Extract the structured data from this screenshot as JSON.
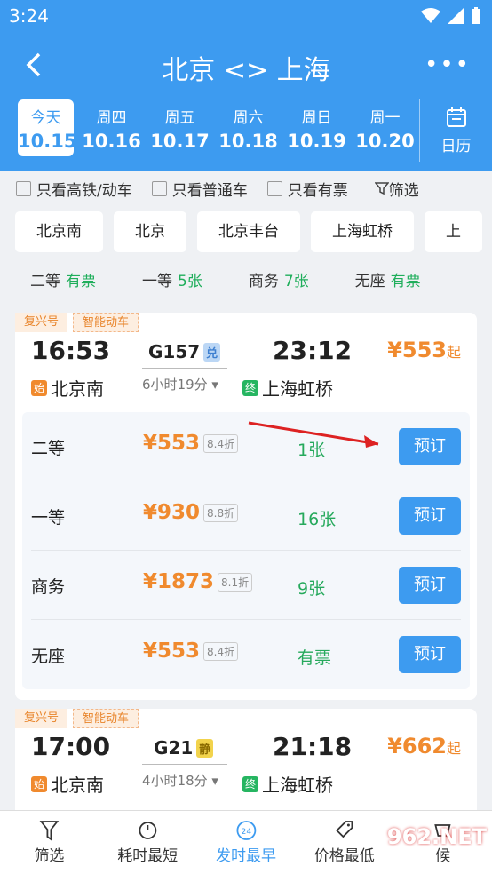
{
  "status_bar": {
    "time": "3:24"
  },
  "nav": {
    "title": "北京 <> 上海",
    "more": "•••"
  },
  "dates": [
    {
      "week": "今天",
      "date": "10.15",
      "active": true
    },
    {
      "week": "周四",
      "date": "10.16"
    },
    {
      "week": "周五",
      "date": "10.17"
    },
    {
      "week": "周六",
      "date": "10.18"
    },
    {
      "week": "周日",
      "date": "10.19"
    },
    {
      "week": "周一",
      "date": "10.20"
    }
  ],
  "calendar_label": "日历",
  "filters": {
    "high_speed": "只看高铁/动车",
    "normal": "只看普通车",
    "available": "只看有票",
    "screen": "筛选"
  },
  "stations": [
    "北京南",
    "北京",
    "北京丰台",
    "上海虹桥",
    "上"
  ],
  "seat_summary": [
    {
      "name": "二等",
      "value": "有票"
    },
    {
      "name": "一等",
      "value": "5张"
    },
    {
      "name": "商务",
      "value": "7张"
    },
    {
      "name": "无座",
      "value": "有票"
    }
  ],
  "trains": [
    {
      "tag1": "复兴号",
      "tag2": "智能动车",
      "dep_time": "16:53",
      "arr_time": "23:12",
      "train_no": "G157",
      "badge": "兑",
      "duration": "6小时19分",
      "start_badge": "始",
      "from": "北京南",
      "end_badge": "终",
      "to": "上海虹桥",
      "price": "¥553",
      "price_suffix": "起",
      "classes": [
        {
          "name": "二等",
          "price": "¥553",
          "discount": "8.4折",
          "count": "1张",
          "button": "预订"
        },
        {
          "name": "一等",
          "price": "¥930",
          "discount": "8.8折",
          "count": "16张",
          "button": "预订"
        },
        {
          "name": "商务",
          "price": "¥1873",
          "discount": "8.1折",
          "count": "9张",
          "button": "预订"
        },
        {
          "name": "无座",
          "price": "¥553",
          "discount": "8.4折",
          "count": "有票",
          "button": "预订"
        }
      ]
    },
    {
      "tag1": "复兴号",
      "tag2": "智能动车",
      "dep_time": "17:00",
      "arr_time": "21:18",
      "train_no": "G21",
      "badge": "静",
      "duration": "4小时18分",
      "start_badge": "始",
      "from": "北京南",
      "end_badge": "终",
      "to": "上海虹桥",
      "price": "¥662",
      "price_suffix": "起"
    }
  ],
  "bottom_tabs": [
    {
      "label": "筛选"
    },
    {
      "label": "耗时最短"
    },
    {
      "label": "发时最早",
      "active": true
    },
    {
      "label": "价格最低"
    },
    {
      "label": "候"
    }
  ],
  "watermark": "962.NET",
  "colors": {
    "primary": "#3d9bf0",
    "orange": "#f08a2e",
    "green": "#26a95c"
  }
}
